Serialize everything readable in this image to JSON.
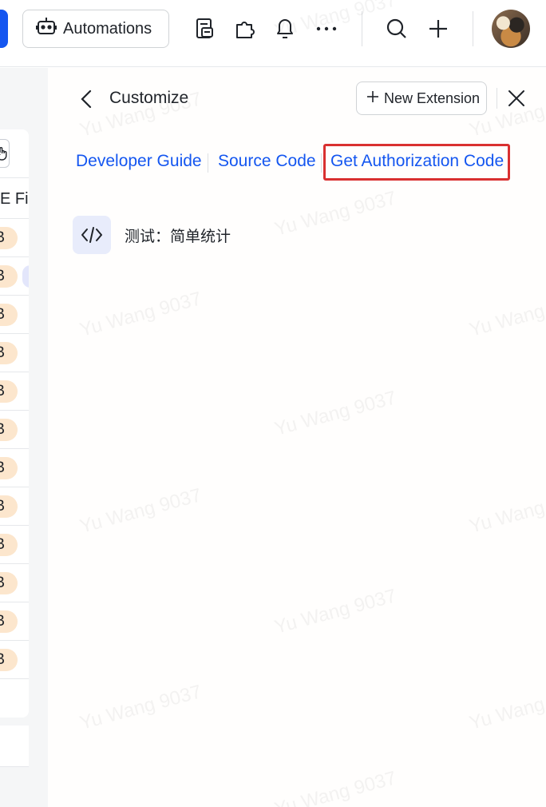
{
  "topbar": {
    "automations_label": "Automations",
    "icons": [
      "robot-icon",
      "form-icon",
      "extension-icon",
      "bell-icon",
      "more-icon",
      "search-icon",
      "plus-icon"
    ]
  },
  "left_table": {
    "column_header": "E Fie",
    "pill_text": "B",
    "row_count": 12
  },
  "panel": {
    "title": "Customize",
    "new_extension_label": "New Extension",
    "links": {
      "developer_guide": "Developer Guide",
      "source_code": "Source Code",
      "get_authorization_code": "Get Authorization Code"
    },
    "extension_item_name": "测试：简单统计"
  },
  "watermark": "Yu Wang 9037",
  "colors": {
    "accent": "#1456f0",
    "highlight_border": "#d93030",
    "pill_bg": "#fce6cd"
  }
}
